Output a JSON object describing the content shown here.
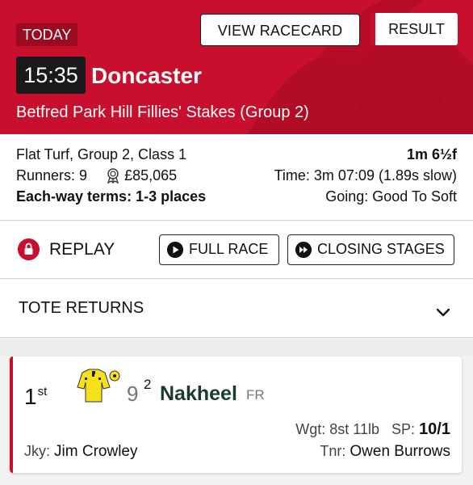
{
  "header": {
    "day_badge": "TODAY",
    "view_racecard_label": "VIEW RACECARD",
    "result_label": "RESULT",
    "time": "15:35",
    "course": "Doncaster",
    "race_name": "Betfred Park Hill Fillies' Stakes (Group 2)",
    "accent_color": "#c8102e"
  },
  "info": {
    "race_type": "Flat Turf, Group 2, Class 1",
    "distance": "1m 6½f",
    "runners": "Runners: 9",
    "prize_icon": "rosette-icon",
    "prize": "£85,065",
    "time": "Time: 3m 07:09 (1.89s slow)",
    "each_way": "Each-way terms: 1-3 places",
    "going": "Going: Good To Soft"
  },
  "replay": {
    "icon": "lock-icon",
    "label": "REPLAY",
    "full_race_label": "FULL RACE",
    "closing_stages_label": "CLOSING STAGES"
  },
  "tote": {
    "label": "TOTE RETURNS",
    "icon": "chevron-down-icon"
  },
  "result": {
    "position": "1",
    "position_suffix": "st",
    "silks_icon": "jockey-silks-icon",
    "number": "9",
    "draw": "2",
    "horse": "Nakheel",
    "country": "FR",
    "weight_label": "Wgt:",
    "weight": "8st 11lb",
    "sp_label": "SP:",
    "sp": "10/1",
    "jockey_label": "Jky:",
    "jockey": "Jim Crowley",
    "trainer_label": "Tnr:",
    "trainer": "Owen Burrows"
  }
}
